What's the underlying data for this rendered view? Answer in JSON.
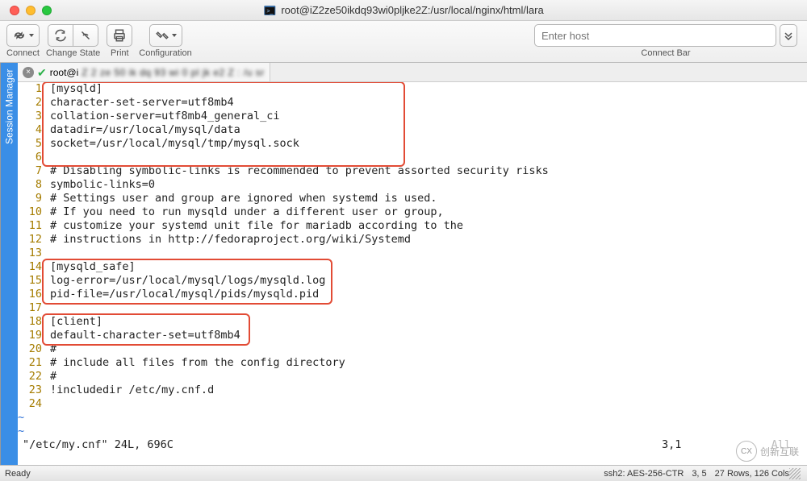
{
  "window": {
    "title": "root@iZ2ze50ikdq93wi0pljke2Z:/usr/local/nginx/html/lara"
  },
  "toolbar": {
    "connect": "Connect",
    "change_state": "Change State",
    "print": "Print",
    "configuration": "Configuration",
    "connect_bar": "Connect Bar",
    "host_placeholder": "Enter host"
  },
  "side_tab": "Session Manager",
  "tab": {
    "label": "root@i"
  },
  "code": {
    "lines": [
      "[mysqld]",
      "character-set-server=utf8mb4",
      "collation-server=utf8mb4_general_ci",
      "datadir=/usr/local/mysql/data",
      "socket=/usr/local/mysql/tmp/mysql.sock",
      "",
      "# Disabling symbolic-links is recommended to prevent assorted security risks",
      "symbolic-links=0",
      "# Settings user and group are ignored when systemd is used.",
      "# If you need to run mysqld under a different user or group,",
      "# customize your systemd unit file for mariadb according to the",
      "# instructions in http://fedoraproject.org/wiki/Systemd",
      "",
      "[mysqld_safe]",
      "log-error=/usr/local/mysql/logs/mysqld.log",
      "pid-file=/usr/local/mysql/pids/mysqld.pid",
      "",
      "[client]",
      "default-character-set=utf8mb4",
      "#",
      "# include all files from the config directory",
      "#",
      "!includedir /etc/my.cnf.d",
      ""
    ],
    "vim_status_left": "\"/etc/my.cnf\" 24L, 696C",
    "vim_cursor": "3,1",
    "vim_scroll": "All"
  },
  "statusbar": {
    "ready": "Ready",
    "cipher": "ssh2: AES-256-CTR",
    "pos": "3, 5",
    "size": "27 Rows, 126 Cols"
  },
  "watermark": {
    "text": "创新互联",
    "abbr": "CX"
  }
}
